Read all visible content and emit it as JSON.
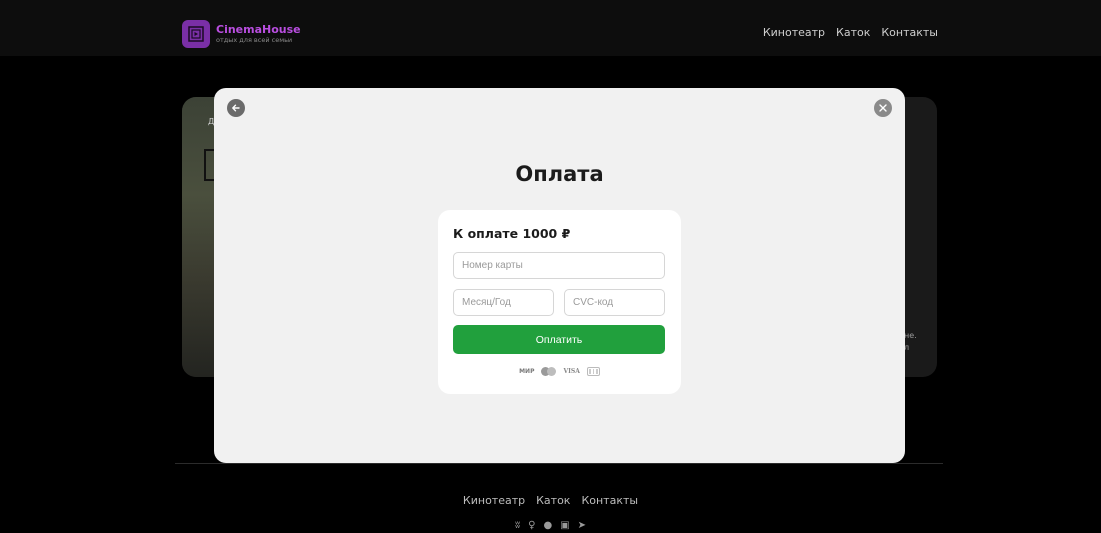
{
  "header": {
    "brand_name": "CinemaHouse",
    "brand_tagline": "отдых для всей семьи",
    "nav": [
      "Кинотеатр",
      "Каток",
      "Контакты"
    ]
  },
  "background": {
    "poster_text": "Д",
    "right_text_1": "не.",
    "right_text_2": "л"
  },
  "modal": {
    "back_icon": "arrow-left-icon",
    "close_icon": "close-icon",
    "title": "Оплата",
    "amount_label": "К оплате 1000 ₽",
    "card_number_placeholder": "Номер карты",
    "month_year_placeholder": "Месяц/Год",
    "cvc_placeholder": "CVC-код",
    "pay_button": "Оплатить",
    "payment_systems": [
      "МИР",
      "Mastercard",
      "VISA",
      "JCB"
    ],
    "mir_label": "МИР",
    "visa_label": "VISA"
  },
  "footer": {
    "nav": [
      "Кинотеатр",
      "Каток",
      "Контакты"
    ],
    "social_icons": [
      "vk-icon",
      "odnoklassniki-icon",
      "whatsapp-icon",
      "youtube-icon",
      "telegram-icon"
    ]
  },
  "colors": {
    "brand": "#7a2fa6",
    "pay_button": "#21a03d",
    "modal_bg": "#f1f1f1"
  }
}
